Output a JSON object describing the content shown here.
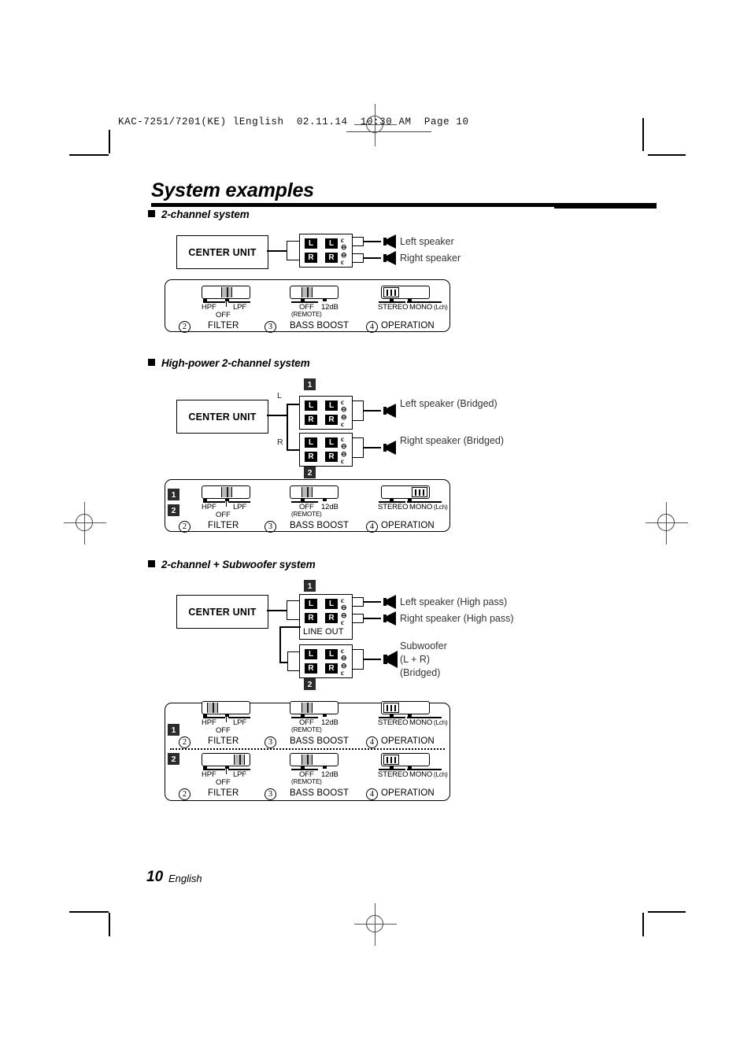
{
  "header": {
    "slug": "KAC-7251/7201(KE) lEnglish  02.11.14  10:30 AM  Page 10"
  },
  "title": "System examples",
  "footer": {
    "page_number": "10",
    "language": "English"
  },
  "labels": {
    "center_unit": "CENTER UNIT",
    "line_out": "LINE OUT",
    "ch_left": "L",
    "ch_right": "R",
    "term_l": "L",
    "term_r": "R",
    "badge_1": "1",
    "badge_2": "2"
  },
  "controls": {
    "filter": {
      "caption": "FILTER",
      "number": "2",
      "left": "HPF",
      "center": "OFF",
      "right": "LPF"
    },
    "bass_boost": {
      "caption": "BASS BOOST",
      "number": "3",
      "left": "OFF",
      "left_sub": "(REMOTE)",
      "right": "12dB"
    },
    "operation": {
      "caption": "OPERATION",
      "number": "4",
      "left": "STEREO",
      "right": "MONO",
      "right_sub": "(Lch)"
    }
  },
  "sections": [
    {
      "id": "two-channel",
      "heading": "2-channel system",
      "speakers": [
        {
          "lines": [
            "Left speaker"
          ]
        },
        {
          "lines": [
            "Right speaker"
          ]
        }
      ],
      "panels": [
        {
          "badges": [],
          "filter_position": "OFF",
          "bass_position": "OFF",
          "operation_position": "STEREO"
        }
      ]
    },
    {
      "id": "high-power-two-channel",
      "heading": "High-power 2-channel system",
      "speakers": [
        {
          "lines": [
            "Left speaker (Bridged)"
          ]
        },
        {
          "lines": [
            "Right speaker (Bridged)"
          ]
        }
      ],
      "panels": [
        {
          "badges": [
            "1",
            "2"
          ],
          "filter_position": "OFF",
          "bass_position": "OFF",
          "operation_position": "MONO"
        }
      ]
    },
    {
      "id": "two-channel-subwoofer",
      "heading": "2-channel + Subwoofer system",
      "speakers": [
        {
          "lines": [
            "Left speaker (High pass)"
          ]
        },
        {
          "lines": [
            "Right speaker (High pass)"
          ]
        },
        {
          "lines": [
            "Subwoofer",
            "(L + R)",
            "(Bridged)"
          ]
        }
      ],
      "panels": [
        {
          "badges": [
            "1"
          ],
          "filter_position": "HPF",
          "bass_position": "OFF",
          "operation_position": "STEREO"
        },
        {
          "badges": [
            "2"
          ],
          "filter_position": "LPF",
          "bass_position": "OFF",
          "operation_position": "STEREO"
        }
      ]
    }
  ]
}
